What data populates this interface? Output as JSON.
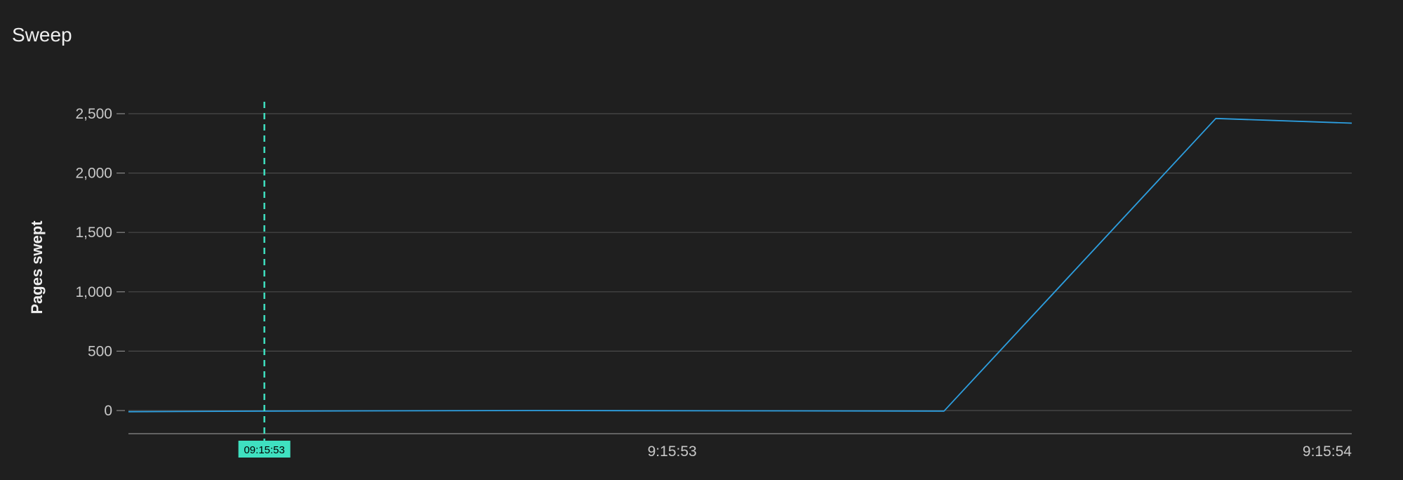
{
  "panel": {
    "title": "Sweep"
  },
  "colors": {
    "background": "#1f1f1f",
    "grid": "#4a4a4a",
    "series": "#2d9fe0",
    "marker": "#3fe0c0"
  },
  "chart_data": {
    "type": "line",
    "ylabel": "Pages swept",
    "xlabel": "",
    "ylim": [
      -200,
      2600
    ],
    "yticks": [
      0,
      500,
      1000,
      1500,
      2000,
      2500
    ],
    "ytick_labels": [
      "0",
      "500",
      "1,000",
      "1,500",
      "2,000",
      "2,500"
    ],
    "xlim": [
      0.1,
      1.0
    ],
    "xticks": [
      0.5,
      1.0
    ],
    "xtick_labels": [
      "9:15:53",
      "9:15:54"
    ],
    "grid": true,
    "series": [
      {
        "x": [
          0.1,
          0.2,
          0.4,
          0.7,
          0.9,
          1.0
        ],
        "values": [
          -10,
          -5,
          0,
          -5,
          2460,
          2420
        ]
      }
    ],
    "marker": {
      "x": 0.2,
      "label": "09:15:53"
    }
  }
}
